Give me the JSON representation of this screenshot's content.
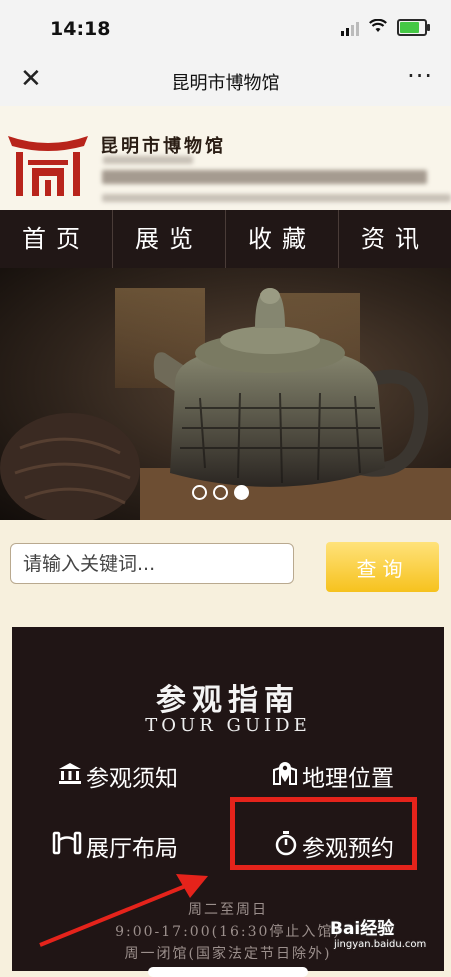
{
  "status_bar": {
    "time": "14:18",
    "battery_level": 0.85,
    "battery_color": "#45c845"
  },
  "nav_bar": {
    "title": "昆明市博物馆",
    "close_symbol": "✕",
    "more_symbol": "···"
  },
  "site_header": {
    "name": "昆明市博物馆",
    "logo_icon": "museum-logo-icon"
  },
  "main_nav": [
    {
      "label": "首页"
    },
    {
      "label": "展览"
    },
    {
      "label": "收藏"
    },
    {
      "label": "资讯"
    }
  ],
  "banner": {
    "slide_count": 3,
    "active_slide": 3
  },
  "search": {
    "placeholder": "请输入关键词...",
    "button_label": "查询"
  },
  "guide": {
    "title": "参观指南",
    "subtitle": "TOUR GUIDE",
    "links": [
      {
        "label": "参观须知",
        "icon": "building-icon"
      },
      {
        "label": "地理位置",
        "icon": "map-pin-icon"
      },
      {
        "label": "展厅布局",
        "icon": "layout-icon"
      },
      {
        "label": "参观预约",
        "icon": "timer-icon"
      }
    ],
    "hours": [
      "周二至周日",
      "9:00-17:00(16:30停止入馆)",
      "周一闭馆(国家法定节日除外)"
    ]
  },
  "annotation": {
    "highlight_color": "#e5231b"
  },
  "watermark": {
    "text": "Bai经验",
    "url": "jingyan.baidu.com"
  }
}
